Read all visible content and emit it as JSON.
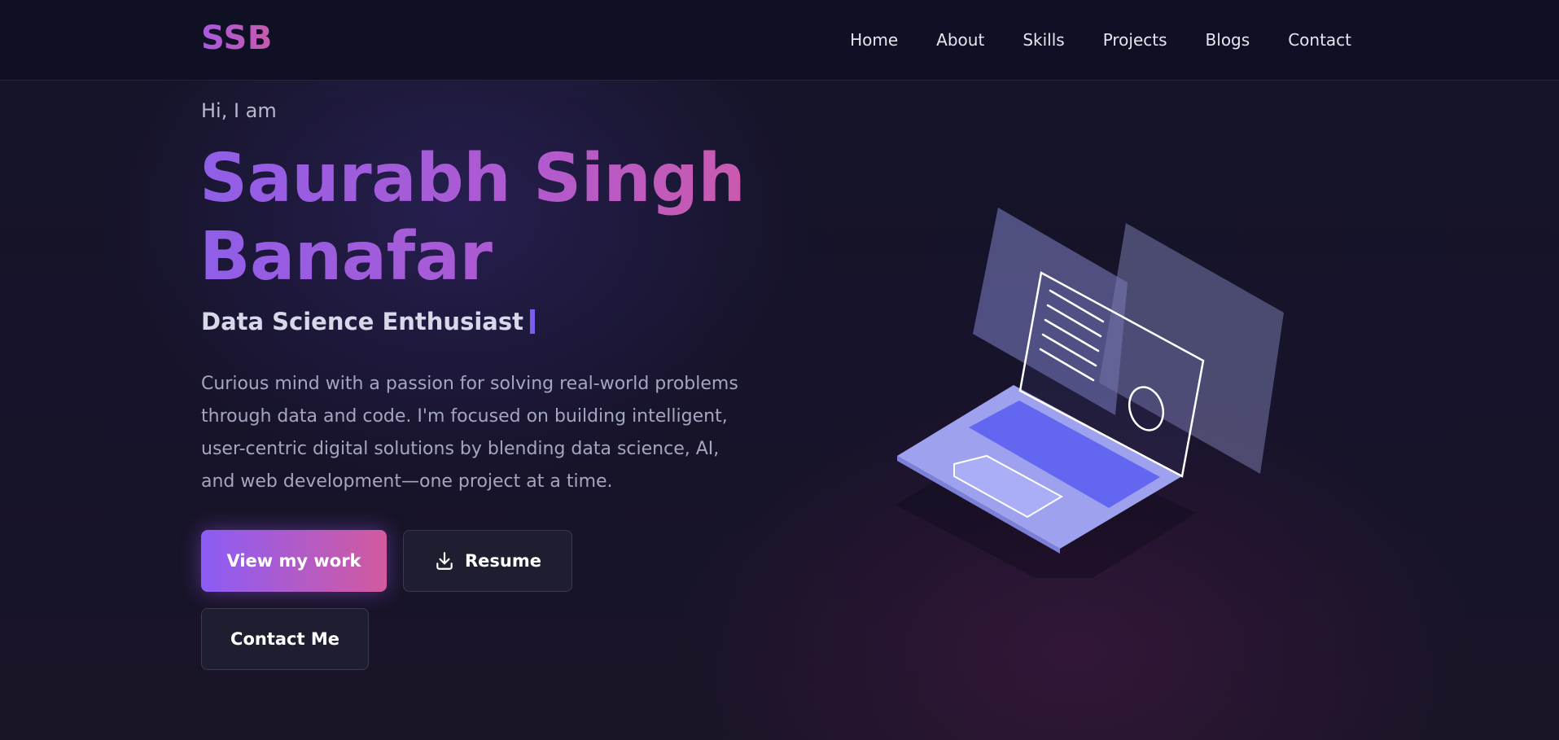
{
  "brand": {
    "logo_text": "SSB"
  },
  "nav": {
    "items": [
      {
        "label": "Home"
      },
      {
        "label": "About"
      },
      {
        "label": "Skills"
      },
      {
        "label": "Projects"
      },
      {
        "label": "Blogs"
      },
      {
        "label": "Contact"
      }
    ]
  },
  "hero": {
    "greeting": "Hi, I am",
    "name": "Saurabh Singh Banafar",
    "role": "Data Science Enthusiast",
    "bio": "Curious mind with a passion for solving real-world problems through data and code. I'm focused on building intelligent, user-centric digital solutions by blending data science, AI, and web development—one project at a time."
  },
  "actions": {
    "view_work_label": "View my work",
    "resume_label": "Resume",
    "contact_label": "Contact Me"
  },
  "colors": {
    "accent_purple": "#8b5cf6",
    "accent_pink": "#d35a9e",
    "background": "#16132a",
    "navbar": "#0f1024"
  },
  "icons": {
    "resume_icon": "download-icon",
    "illustration": "laptop-illustration"
  }
}
